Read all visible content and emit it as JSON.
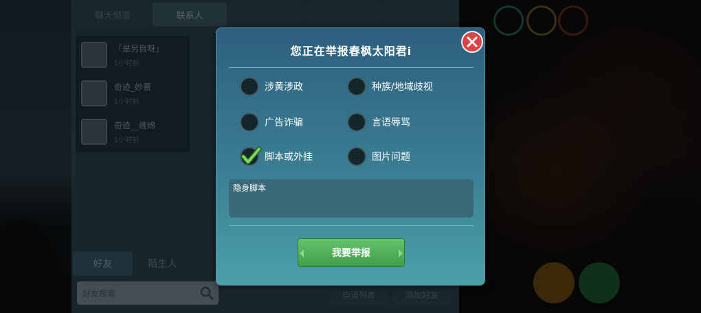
{
  "background": {
    "top_tabs": [
      "聊天频道",
      "联系人",
      "",
      "",
      ""
    ],
    "friends": [
      {
        "name": "「是另自呀」",
        "sub": "1小时前"
      },
      {
        "name": "奇迹_妙蔷",
        "sub": "1小时前"
      },
      {
        "name": "奇迹__缠绵",
        "sub": "1小时前"
      }
    ],
    "bottom_tabs": [
      "好友",
      "陌生人"
    ],
    "search_placeholder": "好友搜索",
    "apply_list_label": "申请列表",
    "add_friend_label": "添加好友"
  },
  "dialog": {
    "title": "您正在举报春枫太阳君i",
    "options": [
      {
        "label": "涉黄涉政",
        "checked": false
      },
      {
        "label": "种族/地域歧视",
        "checked": false
      },
      {
        "label": "广告诈骗",
        "checked": false
      },
      {
        "label": "言语辱骂",
        "checked": false
      },
      {
        "label": "脚本或外挂",
        "checked": true
      },
      {
        "label": "图片问题",
        "checked": false
      }
    ],
    "reason_text": "隐身脚本",
    "submit_label": "我要举报"
  },
  "colors": {
    "accent_green": "#4caf50",
    "close_red": "#d94545"
  },
  "icons": {
    "close": "close-icon",
    "check": "checkmark-icon",
    "search": "search-icon"
  }
}
